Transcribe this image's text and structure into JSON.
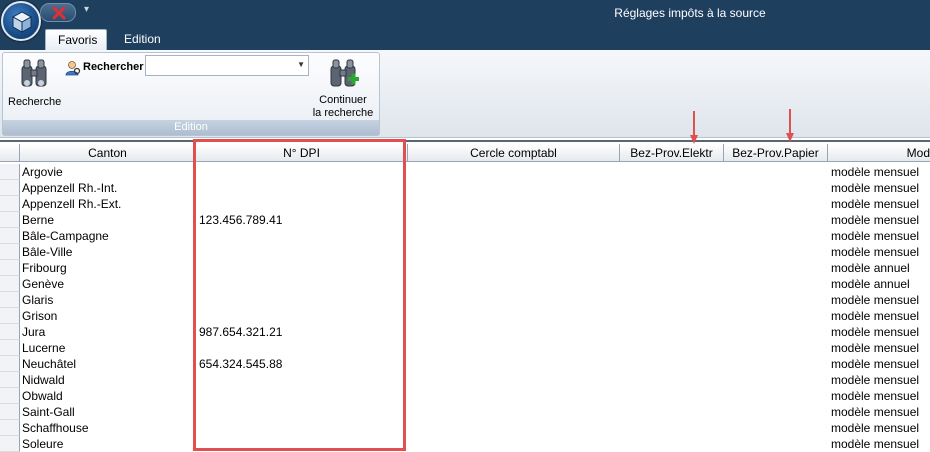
{
  "window": {
    "title": "Réglages impôts à la source"
  },
  "icons": {
    "app_orb": "app-cube-icon",
    "qat_close": "close-red-x-icon",
    "qat_customize": "chevron-down-icon",
    "recherche": "binoculars-icon",
    "rechercher": "user-search-icon",
    "continuer": "binoculars-plus-icon"
  },
  "tabs": [
    {
      "label": "Favoris",
      "active": true
    },
    {
      "label": "Edition",
      "active": false
    }
  ],
  "ribbon": {
    "recherche_label": "Recherche",
    "rechercher_label": "Rechercher",
    "combo_value": "",
    "continuer_line1": "Continuer",
    "continuer_line2": "la recherche",
    "group_label": "Edition"
  },
  "grid": {
    "columns": [
      "Canton",
      "N° DPI",
      "Cercle comptabl",
      "Bez-Prov.Elektr",
      "Bez-Prov.Papier",
      "Mod"
    ],
    "rows": [
      {
        "canton": "Argovie",
        "dpi": "",
        "mod": "modèle mensuel"
      },
      {
        "canton": "Appenzell Rh.-Int.",
        "dpi": "",
        "mod": "modèle mensuel"
      },
      {
        "canton": "Appenzell Rh.-Ext.",
        "dpi": "",
        "mod": "modèle mensuel"
      },
      {
        "canton": "Berne",
        "dpi": "123.456.789.41",
        "mod": "modèle mensuel"
      },
      {
        "canton": "Bâle-Campagne",
        "dpi": "",
        "mod": "modèle mensuel"
      },
      {
        "canton": "Bâle-Ville",
        "dpi": "",
        "mod": "modèle mensuel"
      },
      {
        "canton": "Fribourg",
        "dpi": "",
        "mod": "modèle annuel"
      },
      {
        "canton": "Genève",
        "dpi": "",
        "mod": "modèle annuel"
      },
      {
        "canton": "Glaris",
        "dpi": "",
        "mod": "modèle mensuel"
      },
      {
        "canton": "Grison",
        "dpi": "",
        "mod": "modèle mensuel"
      },
      {
        "canton": "Jura",
        "dpi": "987.654.321.21",
        "mod": "modèle mensuel"
      },
      {
        "canton": "Lucerne",
        "dpi": "",
        "mod": "modèle mensuel"
      },
      {
        "canton": "Neuchâtel",
        "dpi": "654.324.545.88",
        "mod": "modèle mensuel"
      },
      {
        "canton": "Nidwald",
        "dpi": "",
        "mod": "modèle mensuel"
      },
      {
        "canton": "Obwald",
        "dpi": "",
        "mod": "modèle mensuel"
      },
      {
        "canton": "Saint-Gall",
        "dpi": "",
        "mod": "modèle mensuel"
      },
      {
        "canton": "Schaffhouse",
        "dpi": "",
        "mod": "modèle mensuel"
      },
      {
        "canton": "Soleure",
        "dpi": "",
        "mod": "modèle mensuel"
      }
    ]
  },
  "colors": {
    "titlebar": "#1f3f5e",
    "annotation": "#e05050"
  }
}
